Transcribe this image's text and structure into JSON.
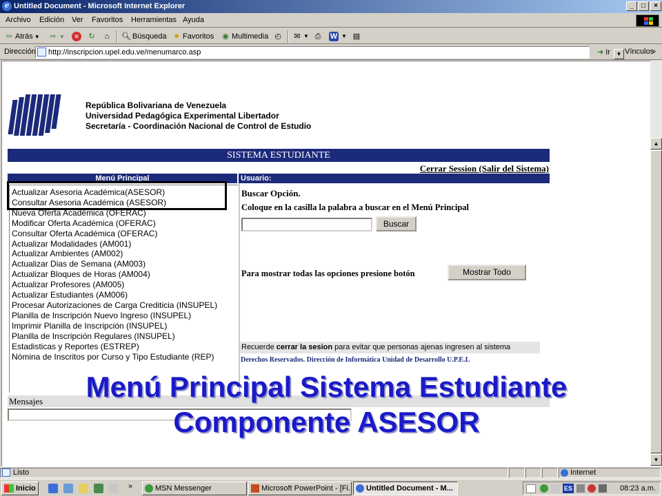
{
  "window": {
    "title": "Untitled Document - Microsoft Internet Explorer",
    "min_glyph": "_",
    "max_glyph": "□",
    "close_glyph": "×"
  },
  "menubar": [
    "Archivo",
    "Edición",
    "Ver",
    "Favoritos",
    "Herramientas",
    "Ayuda"
  ],
  "toolbar": {
    "back": "Atrás",
    "search": "Búsqueda",
    "favorites": "Favoritos",
    "multimedia": "Multimedia"
  },
  "address": {
    "label": "Dirección",
    "url": "http://inscripcion.upel.edu.ve/menumarco.asp",
    "go": "Ir",
    "links": "Vínculos"
  },
  "page": {
    "header_lines": [
      "República Bolivariana de Venezuela",
      "Universidad Pedagógica Experimental Libertador",
      "Secretaría - Coordinación Nacional de Control de Estudio"
    ],
    "system_title": "SISTEMA ESTUDIANTE",
    "logout": "Cerrar Session (Salir del Sistema)",
    "menu_header": "Menú Principal",
    "user_header": "Usuario:",
    "menu_items": [
      "Actualizar Asesoria Académica(ASESOR)",
      "Consultar Asesoria Académica (ASESOR)",
      "Nueva Oferta Académica (OFERAC)",
      "Modificar Oferta Académica (OFERAC)",
      "Consultar Oferta Académica (OFERAC)",
      "Actualizar Modalidades (AM001)",
      "Actualizar Ambientes (AM002)",
      "Actualizar Dias de Semana (AM003)",
      "Actualizar Bloques de Horas (AM004)",
      "Actualizar Profesores (AM005)",
      "Actualizar Estudiantes (AM006)",
      "Procesar Autorizaciones de Carga Crediticia (INSUPEL)",
      "Planilla de Inscripción Nuevo Ingreso (INSUPEL)",
      "Imprimir Planilla de Inscripción (INSUPEL)",
      "Planilla de Inscripción Regulares (INSUPEL)",
      "Estadisticas y Reportes (ESTREP)",
      "Nómina de Inscritos por Curso y Tipo Estudiante (REP)"
    ],
    "search_title": "Buscar Opción.",
    "search_hint": "Coloque en la casilla la palabra a buscar en el Menú Principal",
    "search_value": "",
    "search_button": "Buscar",
    "show_all_hint": "Para mostrar todas las opciones presione botón",
    "show_all_button": "Mostrar Todo",
    "reminder_prefix": "Recuerde ",
    "reminder_bold": "cerrar la sesion",
    "reminder_suffix": " para evitar que personas ajenas ingresen al sistema",
    "copyright": "Derechos Reservados. Dirección de Informática Unidad de Desarrollo U.P.E.L",
    "messages_label": "Mensajes",
    "messages_value": ""
  },
  "overlay": {
    "line1": "Menú Principal Sistema Estudiante",
    "line2": "Componente ASESOR"
  },
  "status": {
    "text": "Listo",
    "zone": "Internet"
  },
  "taskbar": {
    "start": "Inicio",
    "tasks": [
      "MSN Messenger",
      "Microsoft PowerPoint - [Fi...",
      "Untitled Document - M..."
    ],
    "tray_lang": "ES",
    "clock": "08:23 a.m."
  },
  "colors": {
    "navy": "#1c2a7a",
    "overlay_blue": "#1a1ac8",
    "titlebar": "#0a246a"
  }
}
